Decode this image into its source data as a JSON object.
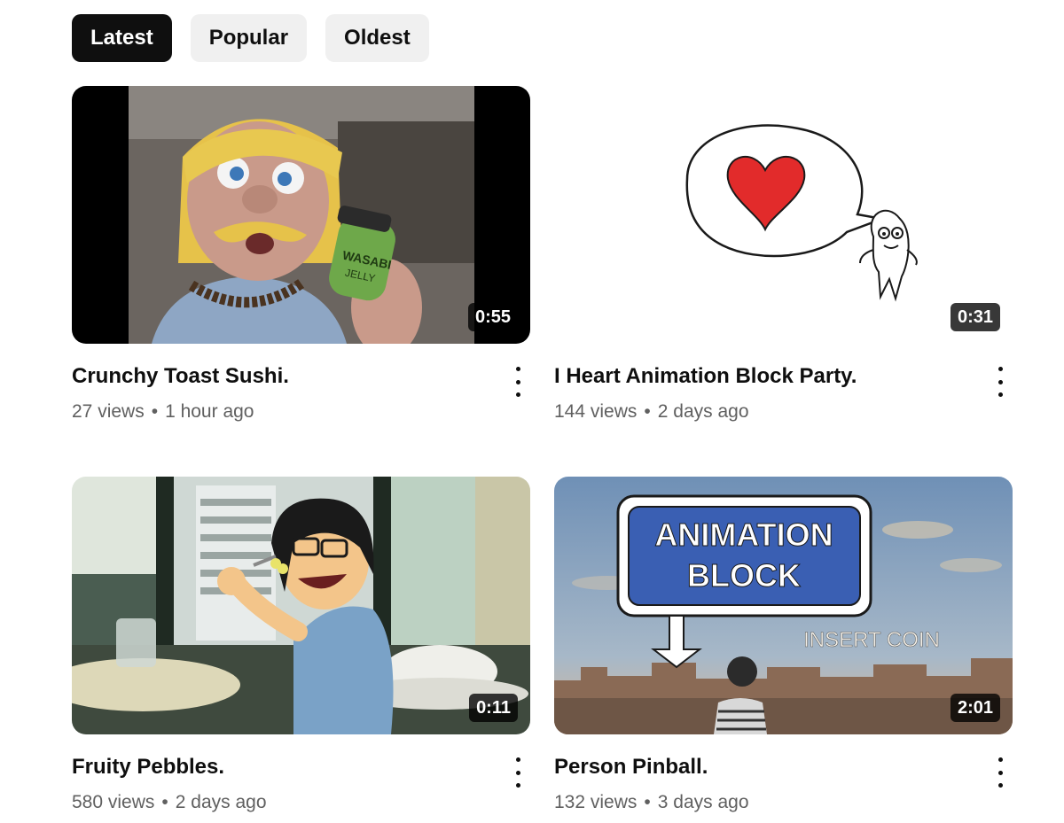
{
  "filters": {
    "latest": "Latest",
    "popular": "Popular",
    "oldest": "Oldest"
  },
  "videos": [
    {
      "title": "Crunchy Toast Sushi.",
      "views": "27 views",
      "age": "1 hour ago",
      "duration": "0:55"
    },
    {
      "title": "I Heart Animation Block Party.",
      "views": "144 views",
      "age": "2 days ago",
      "duration": "0:31"
    },
    {
      "title": "Fruity Pebbles.",
      "views": "580 views",
      "age": "2 days ago",
      "duration": "0:11"
    },
    {
      "title": "Person Pinball.",
      "views": "132 views",
      "age": "3 days ago",
      "duration": "2:01"
    }
  ],
  "thumb_text": {
    "jar_line1": "WASABI",
    "jar_line2": "JELLY",
    "sign_line1": "ANIMATION",
    "sign_line2": "BLOCK",
    "insert_coin": "INSERT COIN"
  },
  "icons": {
    "more": "kebab-menu-icon"
  },
  "colors": {
    "active_chip": "#0f0f0f",
    "chip": "#f0f0f0",
    "secondary_text": "#606060"
  }
}
